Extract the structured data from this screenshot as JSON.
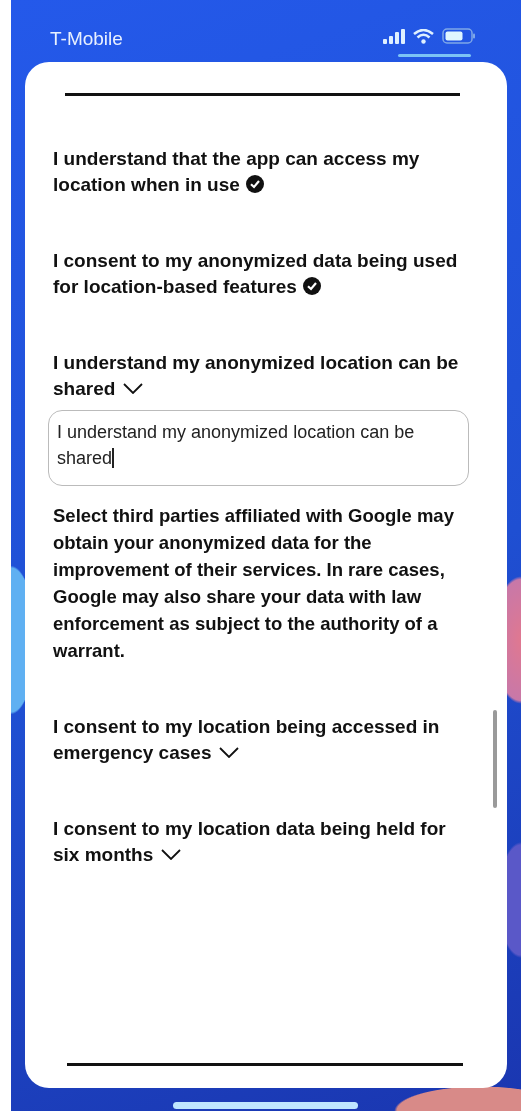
{
  "status_bar": {
    "carrier": "T-Mobile"
  },
  "items": [
    {
      "kind": "confirmed",
      "title": "I understand that the app can access my location when in use"
    },
    {
      "kind": "confirmed",
      "title": "I consent to my anonymized data being used for location-based features"
    },
    {
      "kind": "dropdown",
      "expanded": true,
      "title": "I understand my anonymized location can be shared",
      "answer": "I understand my anonymized location can be shared",
      "description": "Select third  parties affiliated with Google may obtain your anonymized data for the improvement of their services. In rare cases, Google may also share your data with law enforcement as subject to the authority of a warrant."
    },
    {
      "kind": "dropdown",
      "expanded": false,
      "title": "I consent to my location being accessed in emergency cases"
    },
    {
      "kind": "dropdown",
      "expanded": false,
      "title": "I consent to my location data being held for six months"
    }
  ]
}
